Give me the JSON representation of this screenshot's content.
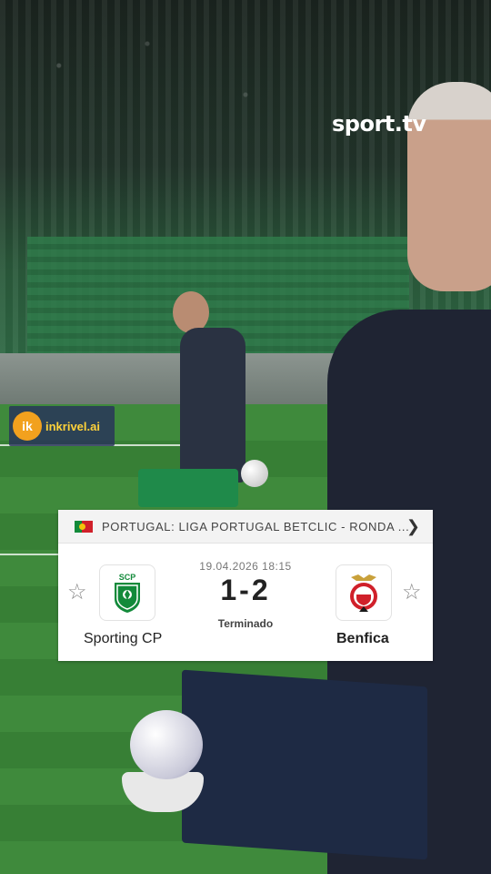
{
  "broadcast": {
    "channel_logo": "sport.tv"
  },
  "sponsor": {
    "icon_letter": "ik",
    "name": "inkrivel.ai"
  },
  "match_card": {
    "country_flag": "portugal-flag-icon",
    "competition": "PORTUGAL: LIGA PORTUGAL BETCLIC - RONDA ...",
    "datetime": "19.04.2026 18:15",
    "score": "1-2",
    "status": "Terminado",
    "home_team": {
      "name": "Sporting CP",
      "crest": "sporting-crest-icon",
      "crest_text": "SCP"
    },
    "away_team": {
      "name": "Benfica",
      "crest": "benfica-crest-icon"
    },
    "colors": {
      "sporting_green": "#128a3a",
      "benfica_red": "#d0202a",
      "card_bg": "#ffffff",
      "header_bg": "#f3f3f3"
    }
  }
}
